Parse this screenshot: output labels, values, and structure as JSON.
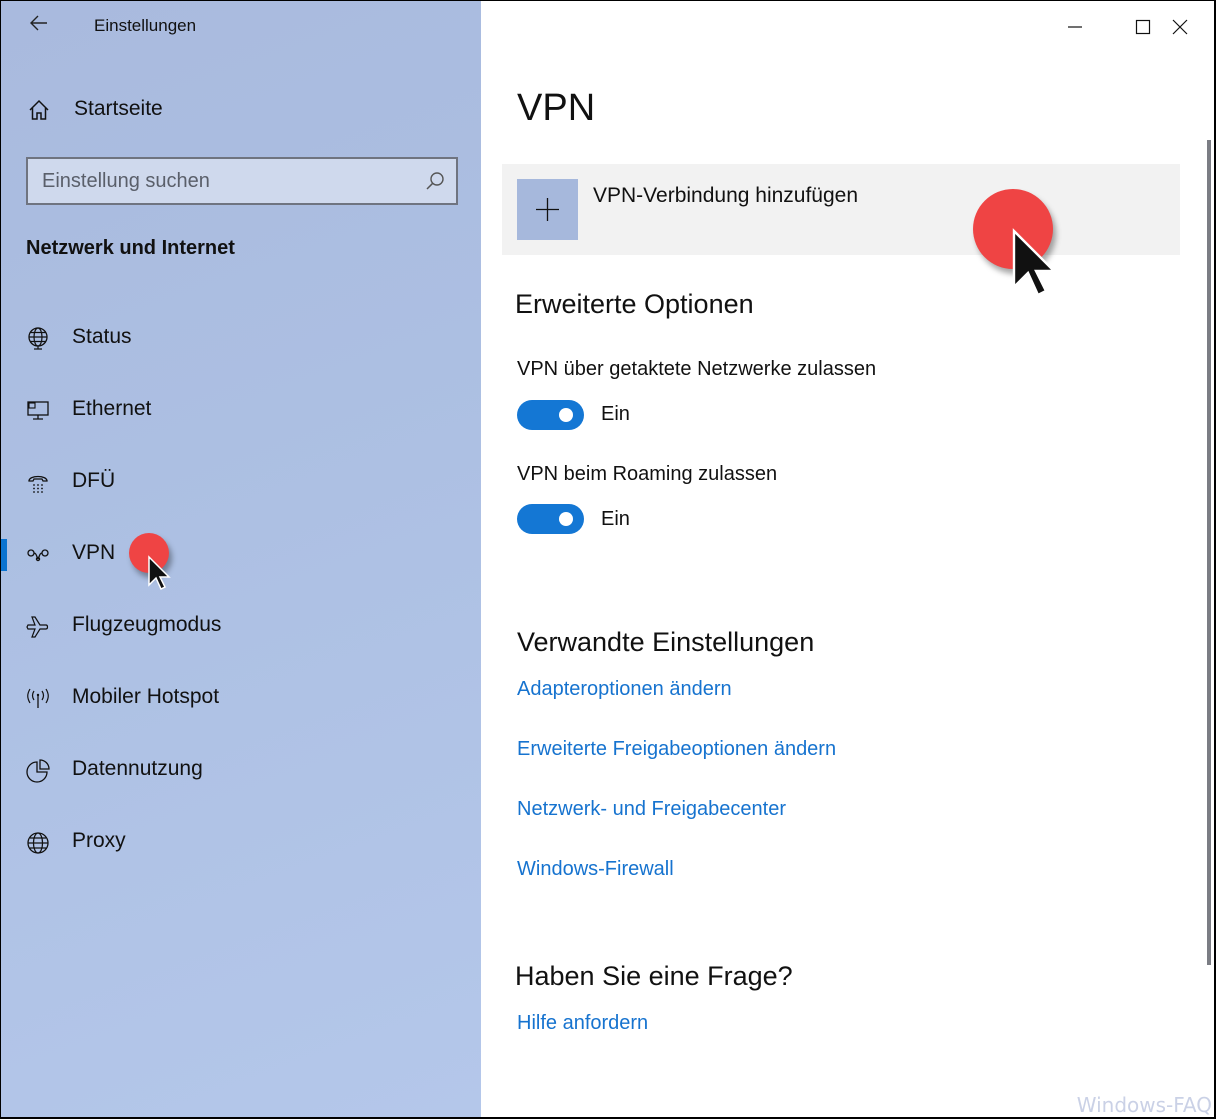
{
  "window": {
    "title": "Einstellungen",
    "controls": {
      "minimize": "minimize-icon",
      "maximize": "maximize-icon",
      "close": "close-icon"
    }
  },
  "sidebar": {
    "back_icon": "arrow-left-icon",
    "home": {
      "label": "Startseite",
      "icon": "home-icon"
    },
    "search": {
      "placeholder": "Einstellung suchen",
      "value": "",
      "icon": "search-icon"
    },
    "section_title": "Netzwerk und Internet",
    "items": [
      {
        "label": "Status",
        "icon": "globe-monitor-icon",
        "selected": false
      },
      {
        "label": "Ethernet",
        "icon": "ethernet-monitor-icon",
        "selected": false
      },
      {
        "label": "DFÜ",
        "icon": "dialup-phone-icon",
        "selected": false
      },
      {
        "label": "VPN",
        "icon": "vpn-icon",
        "selected": true
      },
      {
        "label": "Flugzeugmodus",
        "icon": "airplane-icon",
        "selected": false
      },
      {
        "label": "Mobiler Hotspot",
        "icon": "hotspot-icon",
        "selected": false
      },
      {
        "label": "Datennutzung",
        "icon": "pie-chart-icon",
        "selected": false
      },
      {
        "label": "Proxy",
        "icon": "globe-icon",
        "selected": false
      }
    ],
    "accent_color": "#0a73d0"
  },
  "main": {
    "title": "VPN",
    "add_vpn": {
      "label": "VPN-Verbindung hinzufügen",
      "icon": "plus-icon"
    },
    "advanced": {
      "heading": "Erweiterte Optionen",
      "options": [
        {
          "label": "VPN über getaktete Netzwerke zulassen",
          "state": "Ein",
          "on": true
        },
        {
          "label": "VPN beim Roaming zulassen",
          "state": "Ein",
          "on": true
        }
      ]
    },
    "related": {
      "heading": "Verwandte Einstellungen",
      "links": [
        "Adapteroptionen ändern",
        "Erweiterte Freigabeoptionen ändern",
        "Netzwerk- und Freigabecenter",
        "Windows-Firewall"
      ]
    },
    "question": {
      "heading": "Haben Sie eine Frage?",
      "link": "Hilfe anfordern"
    },
    "link_color": "#1673cf",
    "toggle_color": "#1477d4"
  },
  "watermark": "Windows-FAQ"
}
